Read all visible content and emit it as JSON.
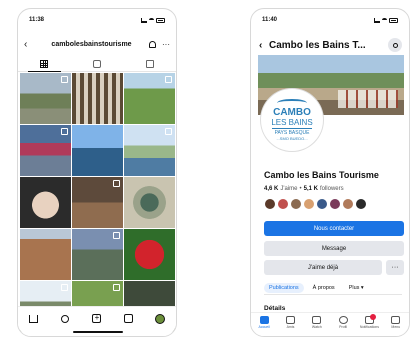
{
  "instagram": {
    "status": {
      "time": "11:38"
    },
    "header": {
      "back_icon": "‹",
      "username": "cambolesbainstourisme",
      "more_icon": "···"
    },
    "grid_photos": [
      "bridge-river",
      "architecture-detail",
      "garden-palm",
      "thermal-building-pink",
      "lake-reflection",
      "mountain-village",
      "spa-massage",
      "wood-interior",
      "peacock-sculpture",
      "stone-arch-door",
      "street-mountains",
      "red-camellia",
      "white-chapel",
      "green-park",
      "garden-alley"
    ]
  },
  "facebook": {
    "status": {
      "time": "11:40"
    },
    "header": {
      "back_icon": "‹",
      "title": "Cambo les Bains T..."
    },
    "logo": {
      "line1": "CAMBO",
      "line2": "LES BAINS",
      "line3": "PAYS BASQUE",
      "line4": "...SMO BUEDO..."
    },
    "page_name": "Cambo les Bains Tourisme",
    "stats": {
      "likes": "4,6 K",
      "likes_label": "J'aime",
      "sep": "•",
      "followers": "5,1 K",
      "followers_label": "followers"
    },
    "buttons": {
      "contact": "Nous contacter",
      "message": "Message",
      "liked": "J'aime déjà",
      "more": "···"
    },
    "tabs": [
      "Publications",
      "À propos",
      "Plus ▾"
    ],
    "section_title": "Détails",
    "nav": [
      {
        "label": "Accueil",
        "icon": "home-icon"
      },
      {
        "label": "Amis",
        "icon": "friends-icon"
      },
      {
        "label": "Watch",
        "icon": "watch-icon"
      },
      {
        "label": "Profil",
        "icon": "profile-icon"
      },
      {
        "label": "Notifications",
        "icon": "bell-icon"
      },
      {
        "label": "Menu",
        "icon": "menu-icon"
      }
    ],
    "friend_avatar_colors": [
      "#5b3a2a",
      "#c0504d",
      "#8a6a50",
      "#d8a070",
      "#3a5a8a",
      "#7a3a5a",
      "#b07a5a",
      "#2a2a2a"
    ]
  }
}
